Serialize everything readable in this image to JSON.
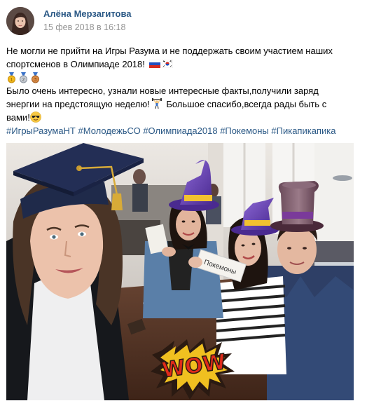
{
  "post": {
    "author": "Алёна Мерзагитова",
    "date": "15 фев 2018 в 16:18",
    "text": {
      "line1": "Не могли не прийти на Игры Разума и не поддержать своим участием наших",
      "line2": "спортсменов в Олимпиаде 2018! ",
      "medals": [
        "gold-medal-icon",
        "silver-medal-icon",
        "bronze-medal-icon"
      ],
      "line3": "Было очень интересно, узнали новые интересные факты,получили заряд",
      "line4a": "энергии на предстоящую неделю!",
      "line4b": "   Большое спасибо,всегда рады быть с",
      "line5": "вами!"
    },
    "hashtags": [
      "#ИгрыРазумаНТ",
      "#МолодежьСО",
      "#Олимпиада2018",
      "#Покемоны",
      "#Пикапикапика"
    ],
    "photo": {
      "card_text": "Покемоны",
      "sticker_text": "WOW"
    },
    "colors": {
      "link": "#2a5885",
      "date": "#939393",
      "text": "#000000"
    }
  }
}
